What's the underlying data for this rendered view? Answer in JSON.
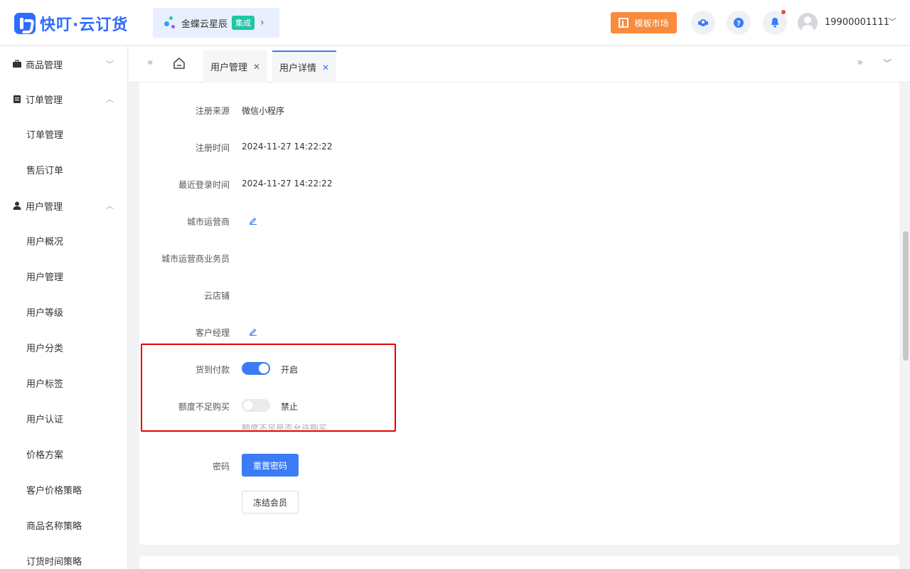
{
  "header": {
    "logo_text": "快叮·云订货",
    "kingdee_text": "金蝶云星辰",
    "kingdee_badge": "集成",
    "kingdee_arrow": "›",
    "template_button": "模板市场",
    "phone": "19900001111",
    "phone_chevron": "﹀"
  },
  "sidebar": {
    "groups": [
      {
        "label": "商品管理",
        "chevron": "﹀"
      },
      {
        "label": "订单管理",
        "chevron": "︿"
      },
      {
        "label": "用户管理",
        "chevron": "︿"
      }
    ],
    "items": [
      "订单管理",
      "售后订单",
      "用户概况",
      "用户管理",
      "用户等级",
      "用户分类",
      "用户标签",
      "用户认证",
      "价格方案",
      "客户价格策略",
      "商品名称策略",
      "订货时间策略"
    ]
  },
  "tabbar": {
    "prev": "«",
    "next": "»",
    "more": "﹀",
    "tabs": [
      {
        "label": "用户管理",
        "close": "✕"
      },
      {
        "label": "用户详情",
        "close": "✕"
      }
    ]
  },
  "detail": {
    "register_source_label": "注册来源",
    "register_source_value": "微信小程序",
    "register_time_label": "注册时间",
    "register_time_value": "2024-11-27 14:22:22",
    "last_login_label": "最近登录时间",
    "last_login_value": "2024-11-27 14:22:22",
    "city_operator_label": "城市运营商",
    "city_operator_staff_label": "城市运营商业务员",
    "cloud_store_label": "云店铺",
    "account_manager_label": "客户经理",
    "cod_label": "货到付款",
    "cod_state": "开启",
    "insufficient_label": "额度不足购买",
    "insufficient_state": "禁止",
    "insufficient_hint": "额度不足是否允许购买",
    "password_label": "密码",
    "reset_password_button": "重置密码",
    "freeze_button": "冻结会员"
  },
  "colors": {
    "primary": "#3b7cf6",
    "template_orange": "#f98b3c",
    "highlight_red": "#e60000"
  }
}
